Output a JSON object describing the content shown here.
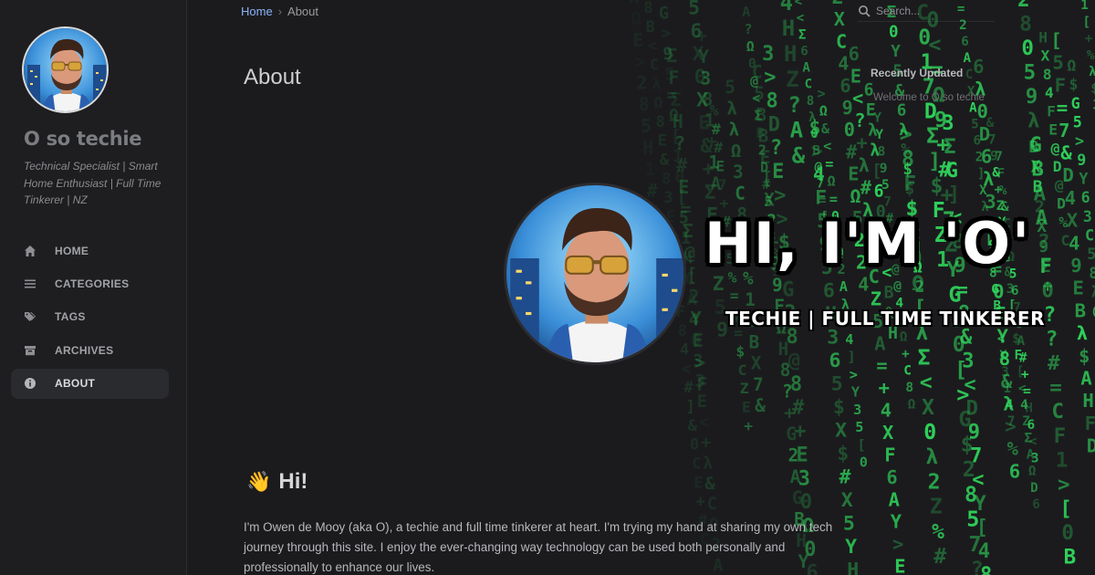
{
  "sidebar": {
    "site_title": "O so techie",
    "site_subtitle": "Technical Specialist | Smart Home Enthusiast | Full Time Tinkerer | NZ",
    "nav": [
      {
        "label": "HOME",
        "icon": "home-icon"
      },
      {
        "label": "CATEGORIES",
        "icon": "list-icon"
      },
      {
        "label": "TAGS",
        "icon": "tags-icon"
      },
      {
        "label": "ARCHIVES",
        "icon": "archive-icon"
      },
      {
        "label": "ABOUT",
        "icon": "info-icon",
        "active": true
      }
    ]
  },
  "breadcrumb": {
    "home": "Home",
    "separator": "›",
    "current": "About"
  },
  "page_title": "About",
  "banner": {
    "headline": "HI, I'M 'O'",
    "tagline": "TECHIE | FULL TIME TINKERER",
    "matrix_color": "#2fd35a"
  },
  "content": {
    "heading": "Hi!",
    "heading_emoji": "👋",
    "intro": "I'm Owen de Mooy (aka O), a techie and full time tinkerer at heart. I'm trying my hand at sharing my own tech journey through this site. I enjoy the ever-changing way technology can be used both personally and professionally to enhance our lives."
  },
  "panel": {
    "search_placeholder": "Search...",
    "recently_updated_title": "Recently Updated",
    "recently_updated": [
      "Welcome to O so techie"
    ]
  },
  "colors": {
    "background": "#1b1b1e",
    "sidebar": "#1e1e21",
    "link": "#8ab4f8",
    "accent_green": "#2fd35a"
  }
}
